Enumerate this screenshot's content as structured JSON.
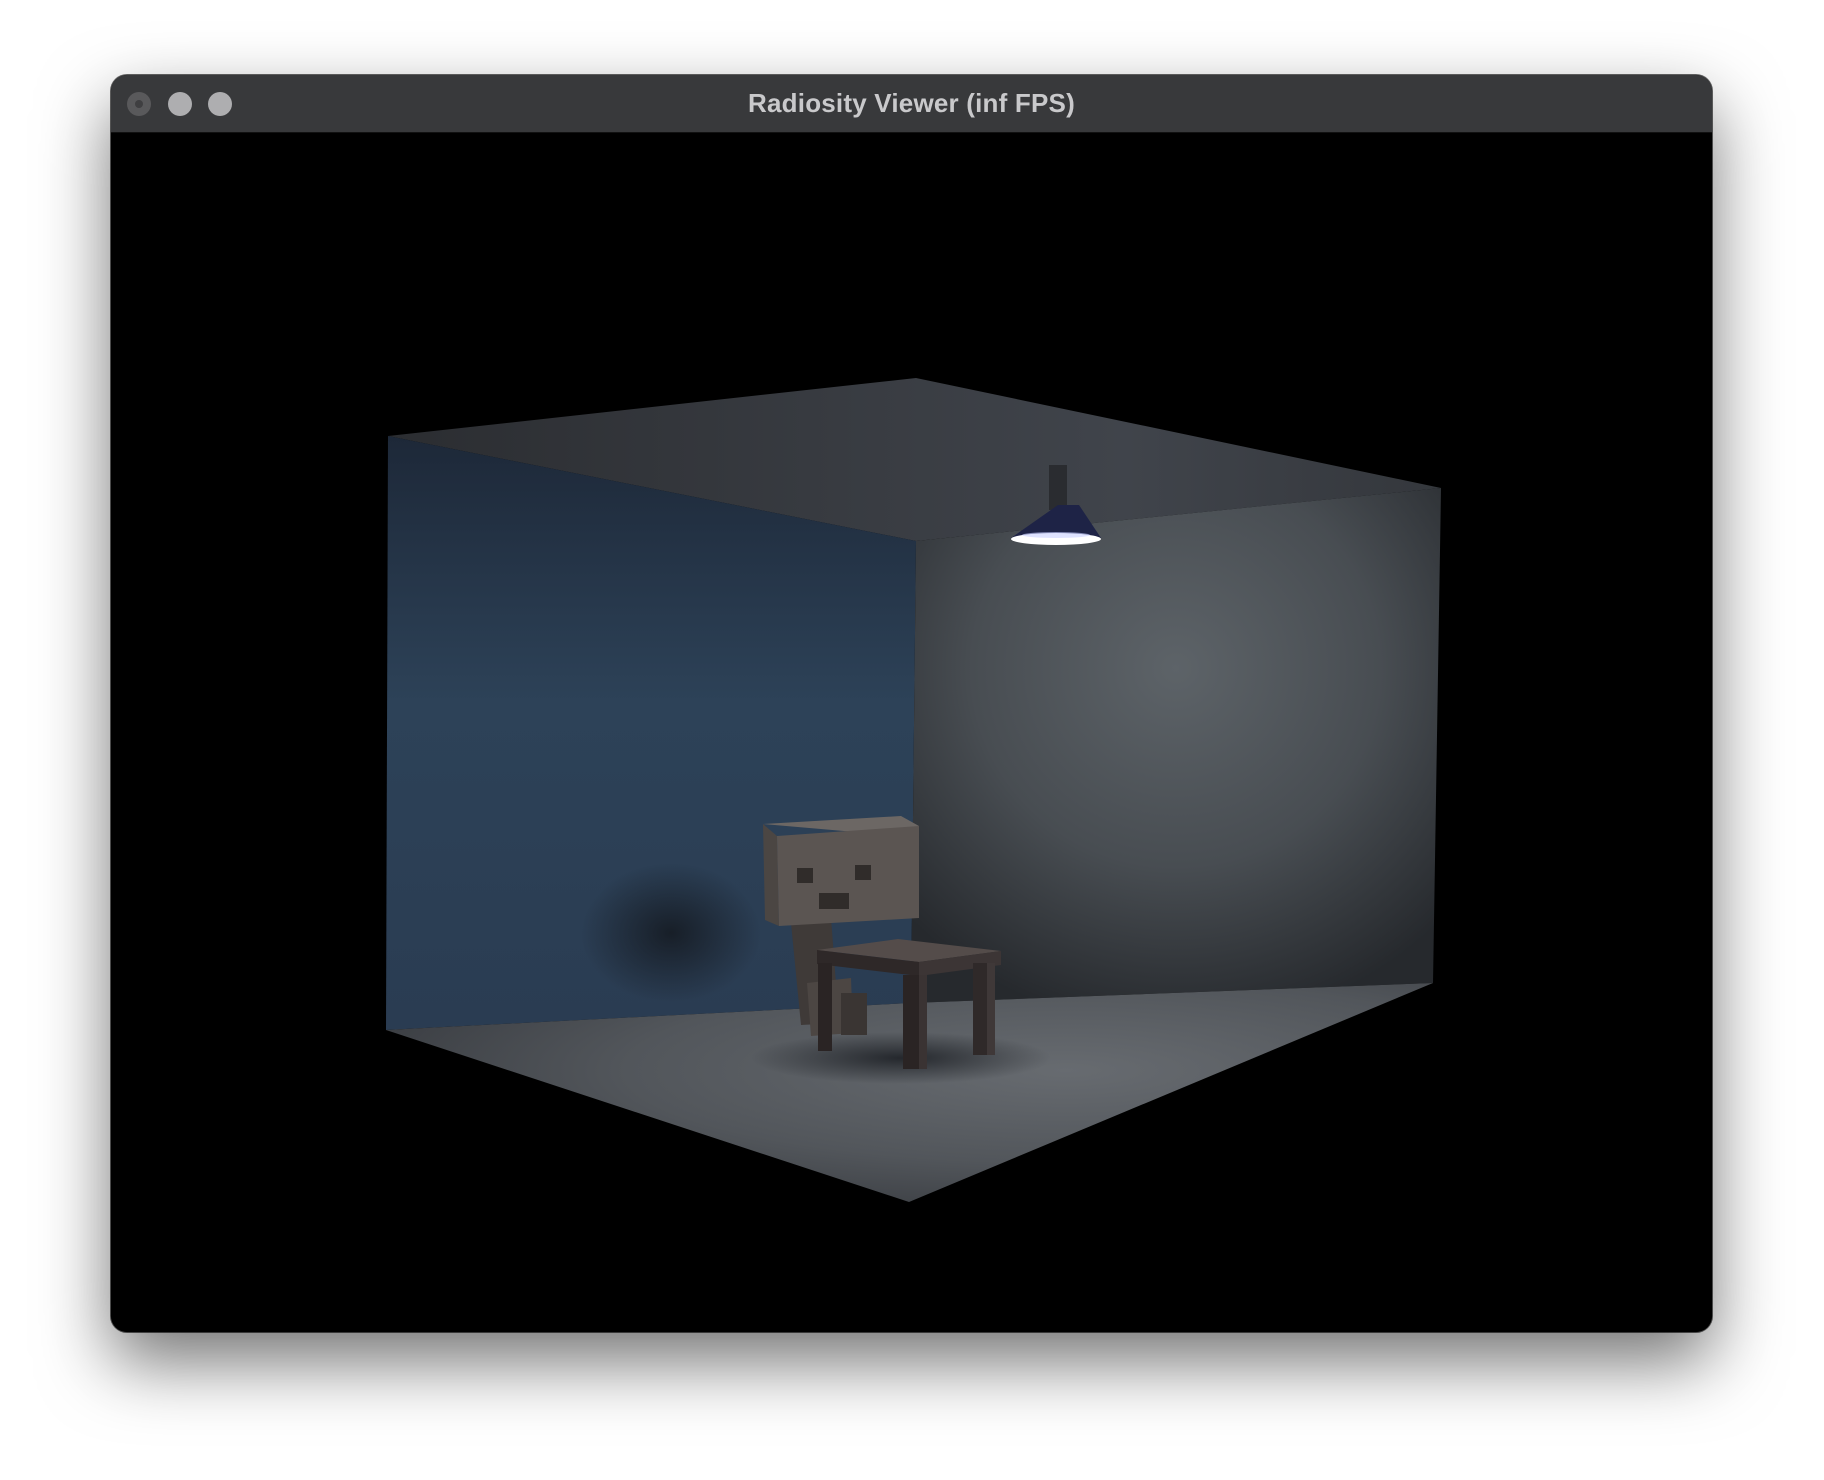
{
  "window": {
    "title": "Radiosity Viewer  (inf FPS)",
    "controls": {
      "close": "close-button",
      "minimize": "minimize-button",
      "zoom": "zoom-button"
    }
  },
  "scene": {
    "icons": [
      "room-scene",
      "ceiling-lamp",
      "robot-figure",
      "table"
    ],
    "colors": {
      "background": "#000000",
      "left_wall": "#2b3f55",
      "right_wall": "#4d5358",
      "ceiling": "#3c3f44",
      "floor": "#55595e",
      "lamp_shade": "#1e2346",
      "lamp_light": "#ffffff",
      "robot": "#5a5552",
      "table": "#3a3333"
    }
  }
}
